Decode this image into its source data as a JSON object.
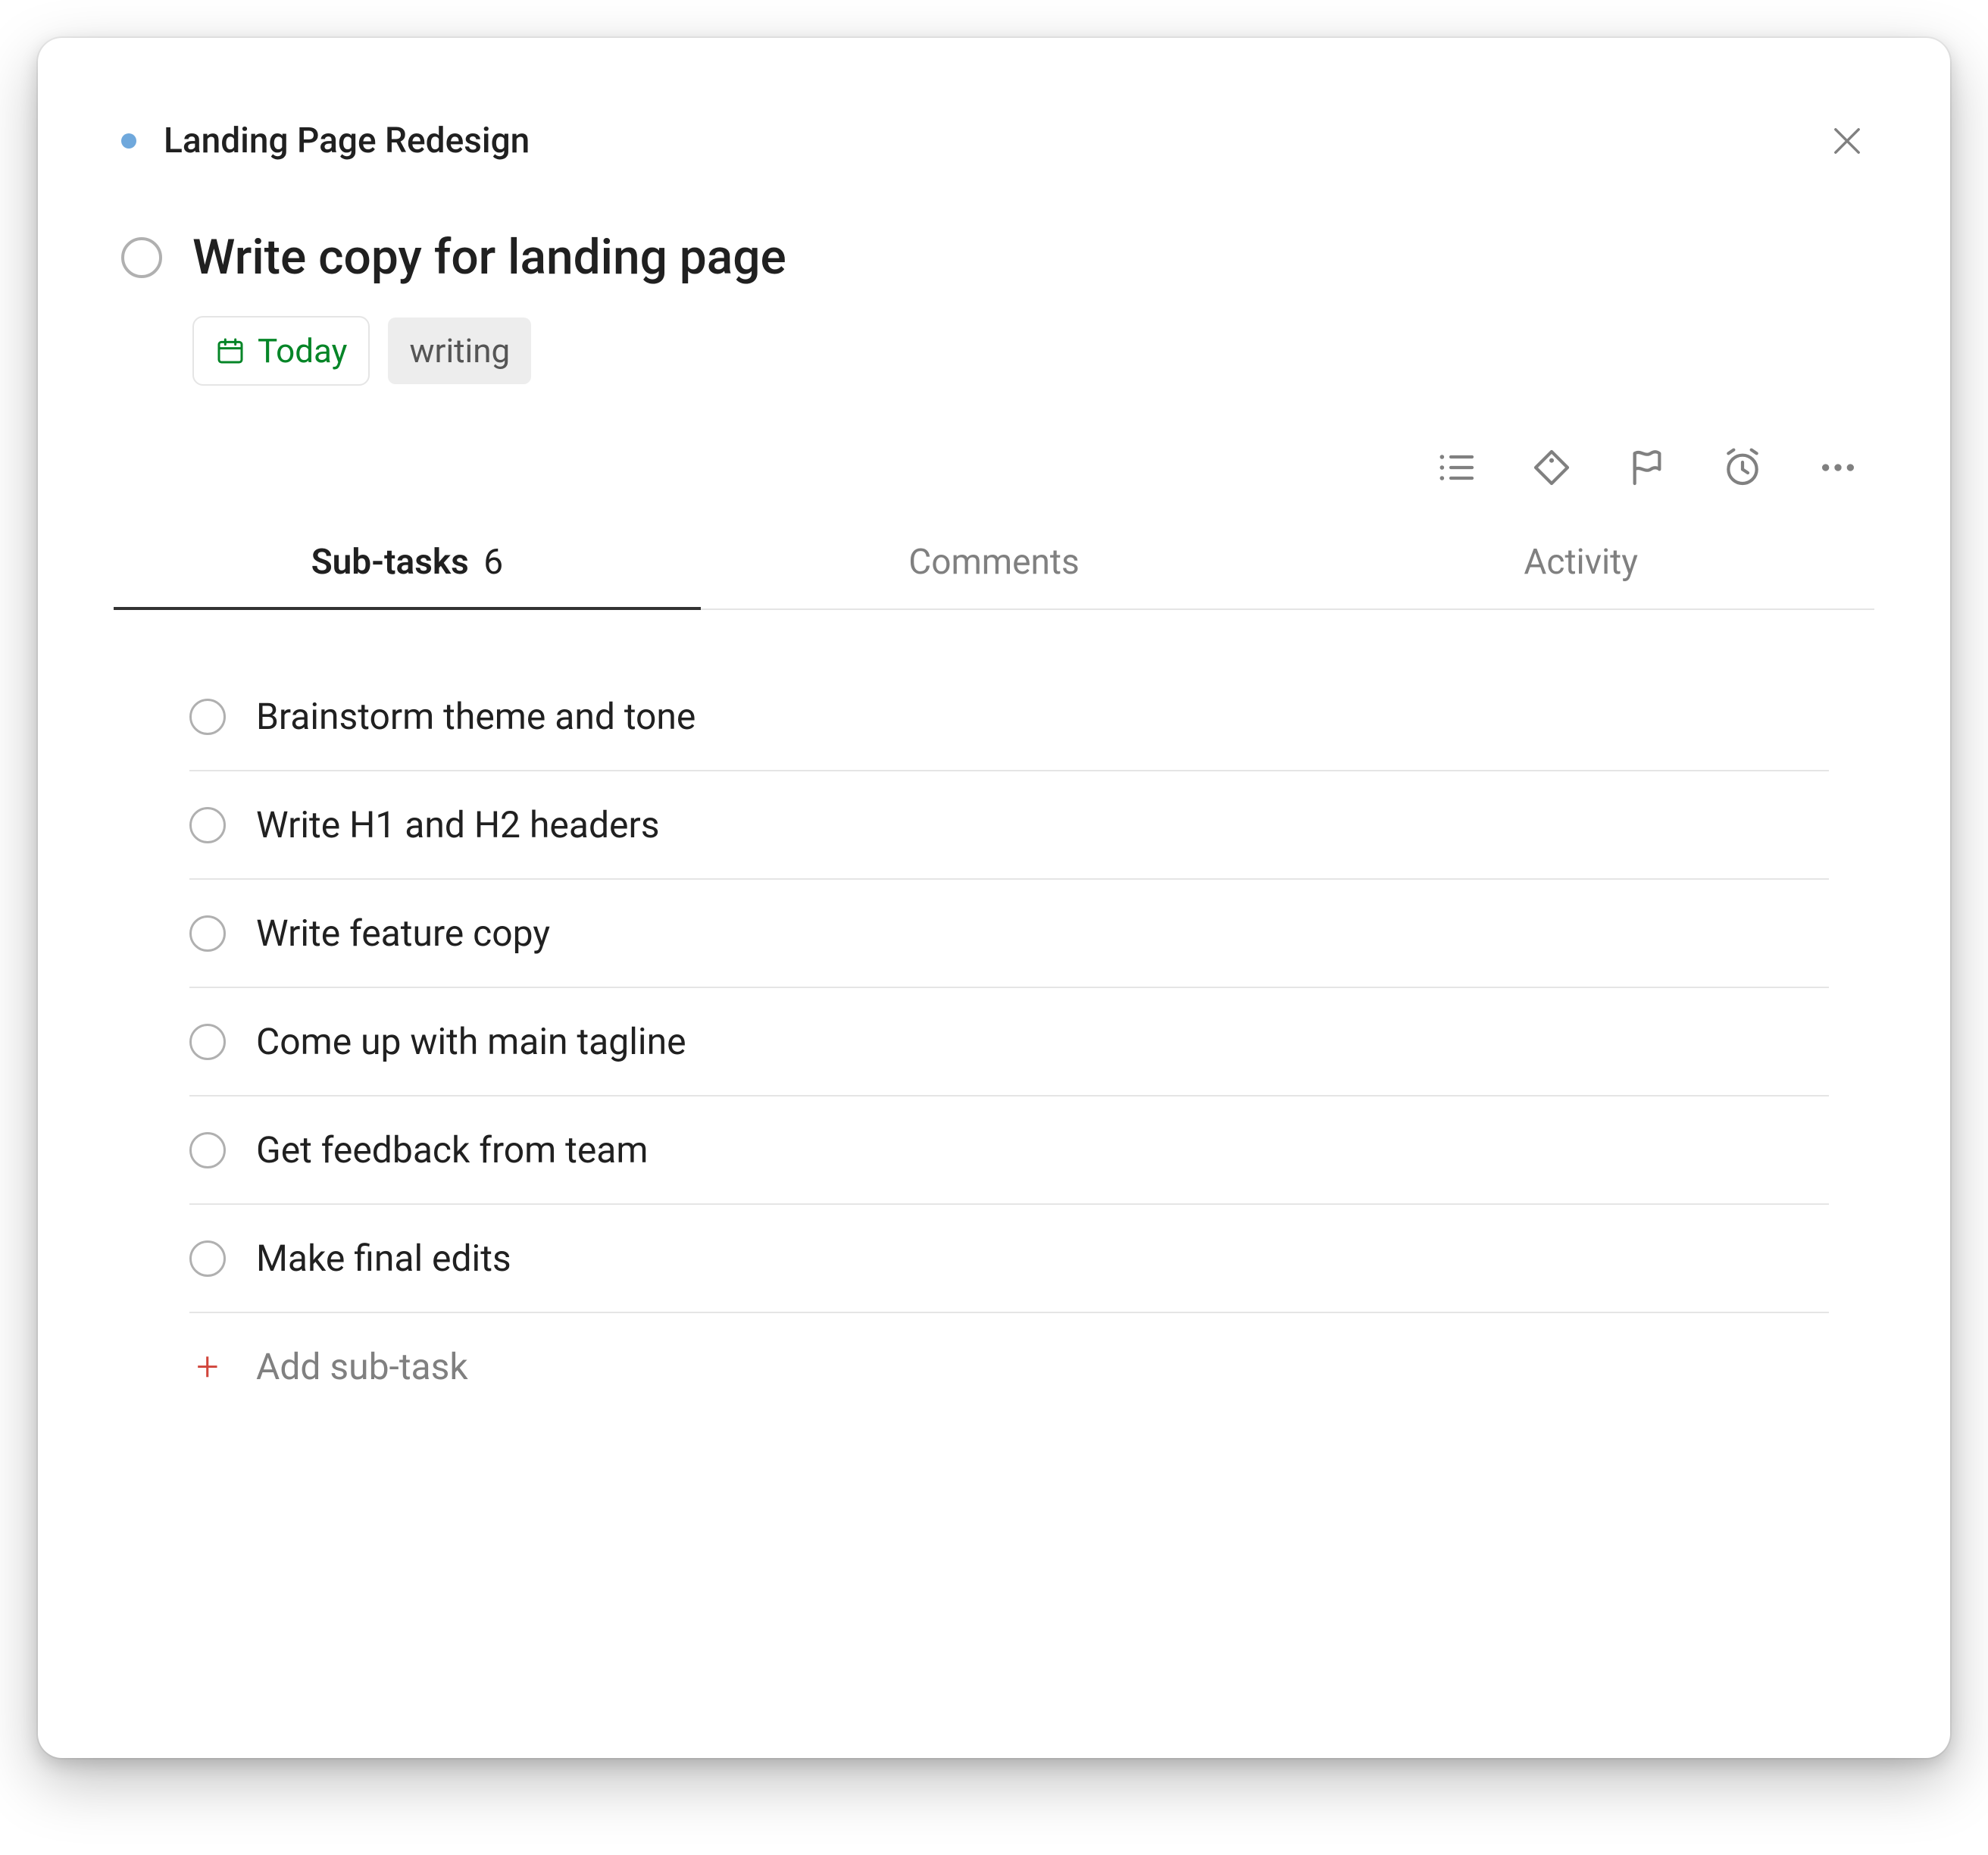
{
  "breadcrumb": {
    "project_name": "Landing Page Redesign",
    "project_color": "#6fa8dc"
  },
  "task": {
    "title": "Write copy for landing page",
    "date_label": "Today",
    "tags": [
      "writing"
    ]
  },
  "tabs": {
    "subtasks_label": "Sub-tasks",
    "subtasks_count": "6",
    "comments_label": "Comments",
    "activity_label": "Activity"
  },
  "subtasks": [
    {
      "title": "Brainstorm theme and tone"
    },
    {
      "title": "Write H1 and H2 headers"
    },
    {
      "title": "Write feature copy"
    },
    {
      "title": "Come up with main tagline"
    },
    {
      "title": "Get feedback from team"
    },
    {
      "title": "Make final edits"
    }
  ],
  "add_subtask_label": "Add sub-task",
  "icons": {
    "list": "list-icon",
    "tag": "tag-icon",
    "flag": "flag-icon",
    "alarm": "alarm-icon",
    "more": "more-icon",
    "close": "close-icon",
    "calendar": "calendar-icon",
    "plus": "plus-icon"
  }
}
